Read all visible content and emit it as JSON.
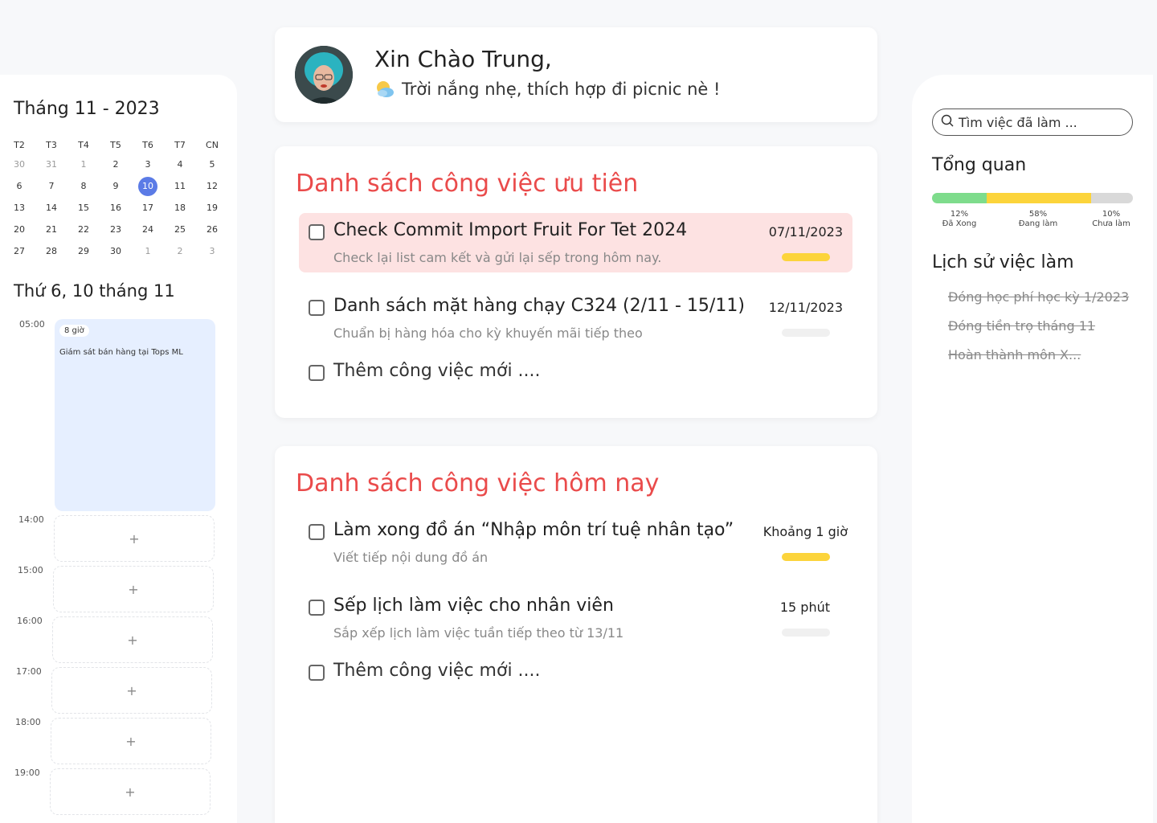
{
  "calendar": {
    "month_title": "Tháng 11 - 2023",
    "weekdays": [
      "T2",
      "T3",
      "T4",
      "T5",
      "T6",
      "T7",
      "CN"
    ],
    "weeks": [
      [
        {
          "d": "30",
          "m": true
        },
        {
          "d": "31",
          "m": true
        },
        {
          "d": "1",
          "m": true
        },
        {
          "d": "2"
        },
        {
          "d": "3"
        },
        {
          "d": "4"
        },
        {
          "d": "5"
        }
      ],
      [
        {
          "d": "6"
        },
        {
          "d": "7"
        },
        {
          "d": "8"
        },
        {
          "d": "9"
        },
        {
          "d": "10",
          "today": true
        },
        {
          "d": "11"
        },
        {
          "d": "12"
        }
      ],
      [
        {
          "d": "13"
        },
        {
          "d": "14"
        },
        {
          "d": "15"
        },
        {
          "d": "16"
        },
        {
          "d": "17"
        },
        {
          "d": "18"
        },
        {
          "d": "19"
        }
      ],
      [
        {
          "d": "20"
        },
        {
          "d": "21"
        },
        {
          "d": "22"
        },
        {
          "d": "23"
        },
        {
          "d": "24"
        },
        {
          "d": "25"
        },
        {
          "d": "26"
        }
      ],
      [
        {
          "d": "27"
        },
        {
          "d": "28"
        },
        {
          "d": "29"
        },
        {
          "d": "30"
        },
        {
          "d": "1",
          "m": true
        },
        {
          "d": "2",
          "m": true
        },
        {
          "d": "3",
          "m": true
        }
      ]
    ],
    "accent_color": "#5b7be6"
  },
  "schedule": {
    "day_title": "Thứ 6, 10 tháng 11",
    "times": [
      "05:00",
      "14:00",
      "15:00",
      "16:00",
      "17:00",
      "18:00",
      "19:00"
    ],
    "event": {
      "badge": "8 giờ",
      "title": "Giám sát bán hàng tại Tops ML"
    },
    "add_symbol": "+"
  },
  "greeting": {
    "title": "Xin Chào Trung,",
    "weather_text": "Trời nắng nhẹ, thích hợp đi picnic nè !"
  },
  "priority": {
    "title": "Danh sách công việc ưu tiên",
    "tasks": [
      {
        "title": "Check Commit Import Fruit For Tet 2024",
        "subtitle": "Check lại list cam kết và gửi lại sếp trong hôm nay.",
        "meta": "07/11/2023",
        "bar": "yellow"
      },
      {
        "title": "Danh sách mặt hàng chạy C324 (2/11 - 15/11)",
        "subtitle": "Chuẩn bị hàng hóa cho kỳ khuyến mãi tiếp theo",
        "meta": "12/11/2023",
        "bar": "gray"
      }
    ],
    "add_label": "Thêm công việc mới ...."
  },
  "today": {
    "title": "Danh sách công việc hôm nay",
    "tasks": [
      {
        "title": "Làm xong đồ án “Nhập môn trí tuệ nhân tạo”",
        "subtitle": "Viết tiếp nội dung đồ án",
        "meta": "Khoảng 1 giờ",
        "bar": "yellow"
      },
      {
        "title": "Sếp lịch làm việc cho nhân viên",
        "subtitle": "Sắp xếp lịch làm việc tuần tiếp theo từ 13/11",
        "meta": "15 phút",
        "bar": "gray"
      }
    ],
    "add_label": "Thêm công việc mới ...."
  },
  "sidebar": {
    "search_placeholder": "Tìm việc đã làm ...",
    "overview_title": "Tổng quan",
    "overview": [
      {
        "pct": "12%",
        "label": "Đã Xong",
        "value": 0.27,
        "color": "#7edc8c"
      },
      {
        "pct": "58%",
        "label": "Đang làm",
        "value": 0.52,
        "color": "#fcd43b"
      },
      {
        "pct": "10%",
        "label": "Chưa làm",
        "value": 0.21,
        "color": "#d9d9d9"
      }
    ],
    "history_title": "Lịch sử việc làm",
    "history": [
      "Đóng học phí học kỳ 1/2023",
      "Đóng tiền trọ tháng 11",
      "Hoàn thành môn X..."
    ]
  },
  "colors": {
    "title_red": "#ea4b4b",
    "highlight_bg": "#fde2e2",
    "progress_yellow": "#fcd43b",
    "progress_gray": "#f0f0f0"
  }
}
